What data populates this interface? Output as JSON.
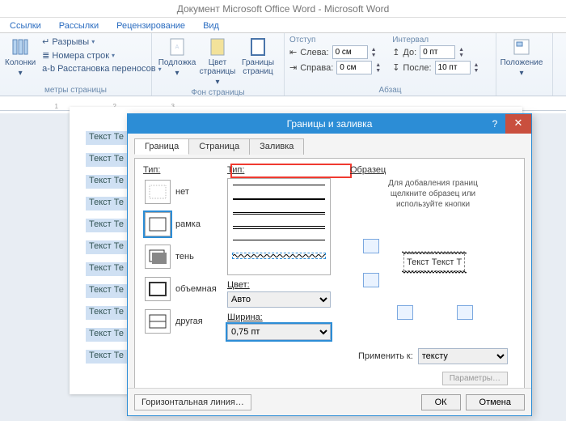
{
  "title": "Документ Microsoft Office Word - Microsoft Word",
  "menu": {
    "links": "Ссылки",
    "mail": "Рассылки",
    "review": "Рецензирование",
    "view": "Вид"
  },
  "ribbon": {
    "breaks": "Разрывы",
    "linenum": "Номера строк",
    "hyphen": "Расстановка переносов",
    "columns": "Колонки",
    "pagegroup": "метры страницы",
    "watermark": "Подложка",
    "pagecolor": "Цвет страницы",
    "pageborders": "Границы страниц",
    "bggroup": "Фон страницы",
    "indent": "Отступ",
    "left": "Слева:",
    "right": "Справа:",
    "leftval": "0 см",
    "rightval": "0 см",
    "spacing": "Интервал",
    "before": "До:",
    "after": "После:",
    "beforeval": "0 пт",
    "afterval": "10 пт",
    "paragroup": "Абзац",
    "position": "Положение"
  },
  "doc_line": "Текст Те",
  "dialog": {
    "title": "Границы и заливка",
    "tabs": {
      "border": "Граница",
      "page": "Страница",
      "fill": "Заливка"
    },
    "tip": "Тип:",
    "tip2": "Тип:",
    "types": {
      "none": "нет",
      "box": "рамка",
      "shadow": "тень",
      "threeD": "объемная",
      "custom": "другая"
    },
    "color": "Цвет:",
    "color_auto": "Авто",
    "width": "Ширина:",
    "width_val": "0,75 пт",
    "sample": "Образец",
    "sample_msg": "Для добавления границ щелкните образец или используйте кнопки",
    "sample_text": "Текст Текст Т",
    "apply": "Применить к:",
    "apply_val": "тексту",
    "params": "Параметры…",
    "hline": "Горизонтальная линия…",
    "ok": "ОК",
    "cancel": "Отмена"
  }
}
